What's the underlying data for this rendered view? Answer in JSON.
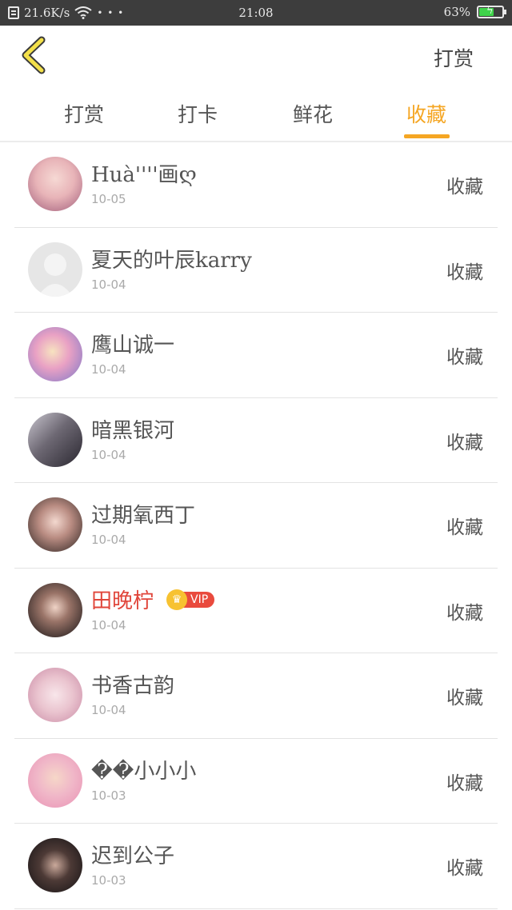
{
  "statusbar": {
    "speed": "21.6K/s",
    "dots": "• • •",
    "time": "21:08",
    "battery_percent": "63%",
    "battery_level": 0.63,
    "battery_color": "#3fd34a"
  },
  "header": {
    "back_icon": "chevron-left-icon",
    "right_action": "打赏"
  },
  "tabs": [
    {
      "label": "打赏",
      "active": false
    },
    {
      "label": "打卡",
      "active": false
    },
    {
      "label": "鲜花",
      "active": false
    },
    {
      "label": "收藏",
      "active": true
    }
  ],
  "accent_color": "#f5a623",
  "rows": [
    {
      "name": "Huà''''画ღ",
      "date": "10-05",
      "action": "收藏"
    },
    {
      "name": "夏天的叶辰karry",
      "date": "10-04",
      "action": "收藏"
    },
    {
      "name": "鹰山诚一",
      "date": "10-04",
      "action": "收藏"
    },
    {
      "name": "暗黑银河",
      "date": "10-04",
      "action": "收藏"
    },
    {
      "name": "过期氧西丁",
      "date": "10-04",
      "action": "收藏"
    },
    {
      "name": "田晚柠",
      "date": "10-04",
      "action": "收藏",
      "vip": "VIP"
    },
    {
      "name": "书香古韵",
      "date": "10-04",
      "action": "收藏"
    },
    {
      "name": "��小小小",
      "date": "10-03",
      "action": "收藏"
    },
    {
      "name": "迟到公子",
      "date": "10-03",
      "action": "收藏"
    }
  ]
}
